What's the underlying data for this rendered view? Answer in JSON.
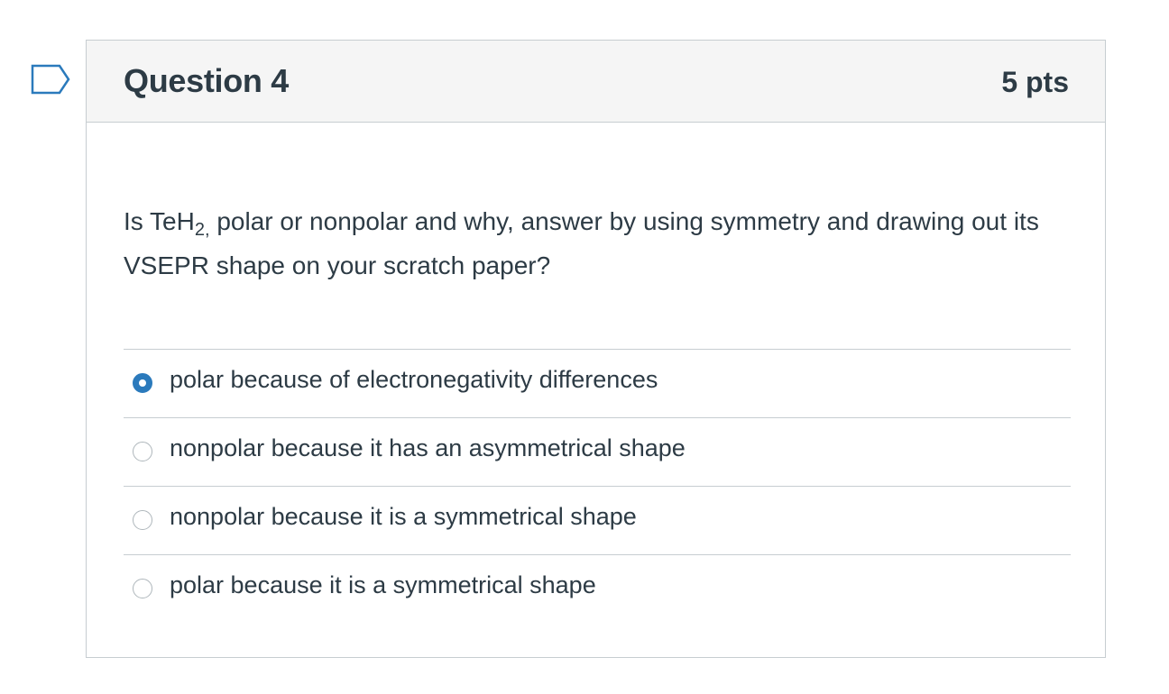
{
  "question": {
    "title": "Question 4",
    "points": "5 pts",
    "text_before_formula": "Is TeH",
    "formula_subscript": "2,",
    "text_after_formula": " polar or nonpolar and why, answer by using symmetry and drawing out its VSEPR shape on your scratch paper?",
    "flag_icon": "flag-icon"
  },
  "answers": [
    {
      "label": "polar because of electronegativity differences",
      "selected": true
    },
    {
      "label": "nonpolar because it has an asymmetrical shape",
      "selected": false
    },
    {
      "label": "nonpolar because it is a symmetrical shape",
      "selected": false
    },
    {
      "label": "polar because it is a symmetrical shape",
      "selected": false
    }
  ],
  "colors": {
    "accent": "#2b7abc",
    "text": "#2d3b45",
    "header_bg": "#f5f5f5",
    "border": "#c7cdd1"
  }
}
